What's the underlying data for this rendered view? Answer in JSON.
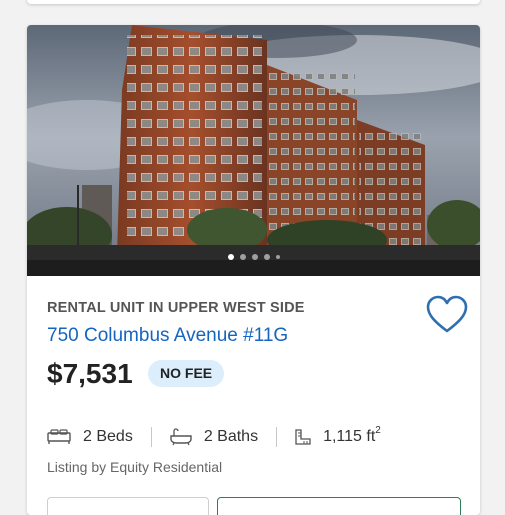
{
  "listing": {
    "type_label": "RENTAL UNIT IN UPPER WEST SIDE",
    "address": "750 Columbus Avenue #11G",
    "price": "$7,531",
    "fee_badge": "NO FEE",
    "beds": "2 Beds",
    "baths": "2 Baths",
    "area_value": "1,115 ft",
    "area_unit_sup": "2",
    "broker": "Listing by Equity Residential",
    "photo_dots": 5,
    "active_photo": 1
  },
  "icons": {
    "favorite": "heart-outline-icon",
    "beds": "bed-icon",
    "baths": "bathtub-icon",
    "area": "ruler-icon"
  },
  "colors": {
    "accent_blue": "#1565c0",
    "badge_bg": "#dcedfb",
    "heart": "#2f6fb0",
    "button_border_green": "#2e7d59"
  }
}
